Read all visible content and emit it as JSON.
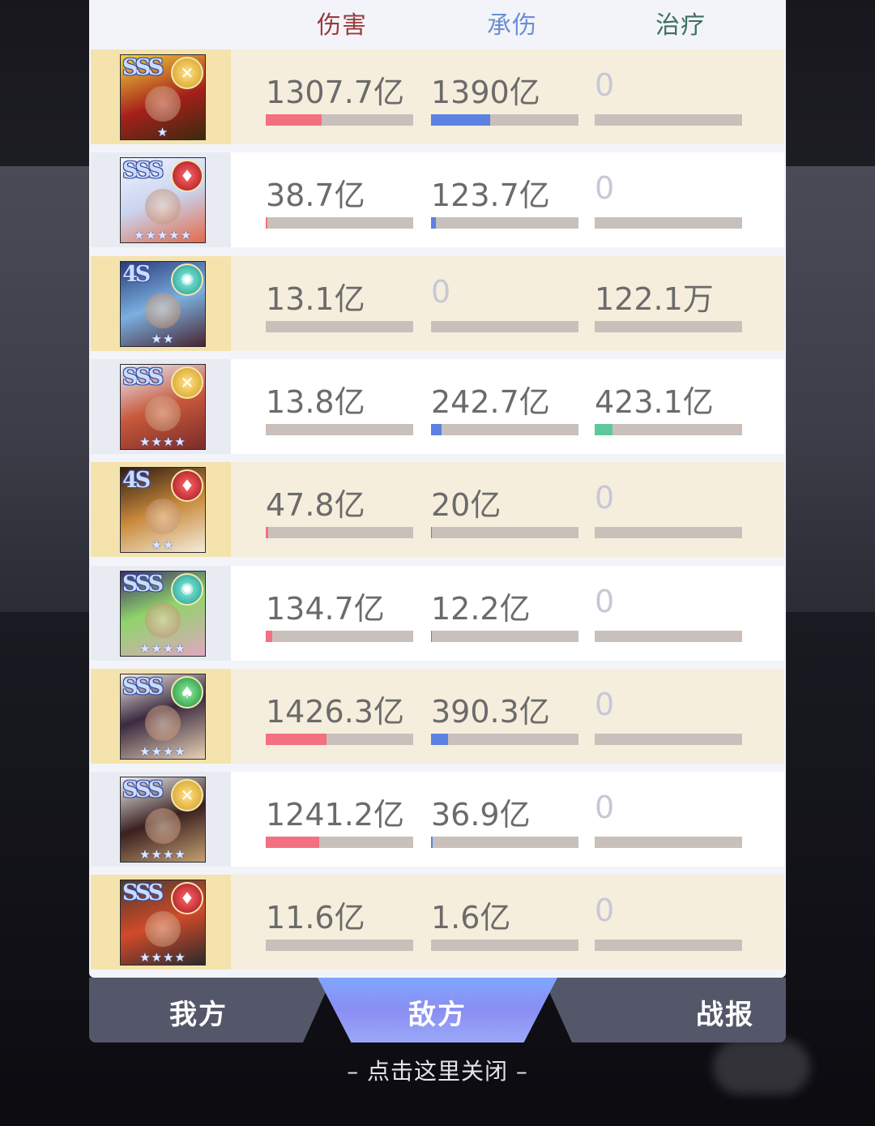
{
  "headers": {
    "damage": "伤害",
    "tanked": "承伤",
    "healing": "治疗"
  },
  "colors": {
    "damage_bar": "#f2707f",
    "tank_bar": "#5b82e3",
    "heal_bar": "#5cc99b",
    "active_tab": "#8a8ef3"
  },
  "rows": [
    {
      "grade": "SSS",
      "element": "light",
      "stars": "★",
      "damage": "1307.7亿",
      "tanked": "1390亿",
      "healing": "0",
      "damage_frac": 0.38,
      "tank_frac": 0.4,
      "heal_frac": 0
    },
    {
      "grade": "SSS",
      "element": "fire",
      "stars": "★★★★★",
      "damage": "38.7亿",
      "tanked": "123.7亿",
      "healing": "0",
      "damage_frac": 0.01,
      "tank_frac": 0.035,
      "heal_frac": 0
    },
    {
      "grade": "4S",
      "element": "wind",
      "stars": "★★",
      "damage": "13.1亿",
      "tanked": "0",
      "healing": "122.1万",
      "damage_frac": 0,
      "tank_frac": 0,
      "heal_frac": 0
    },
    {
      "grade": "SSS",
      "element": "light",
      "stars": "★★★★",
      "damage": "13.8亿",
      "tanked": "242.7亿",
      "healing": "423.1亿",
      "damage_frac": 0,
      "tank_frac": 0.07,
      "heal_frac": 0.12
    },
    {
      "grade": "4S",
      "element": "fire",
      "stars": "★★",
      "damage": "47.8亿",
      "tanked": "20亿",
      "healing": "0",
      "damage_frac": 0.015,
      "tank_frac": 0.006,
      "heal_frac": 0
    },
    {
      "grade": "SSS",
      "element": "wind",
      "stars": "★★★★",
      "damage": "134.7亿",
      "tanked": "12.2亿",
      "healing": "0",
      "damage_frac": 0.045,
      "tank_frac": 0.004,
      "heal_frac": 0
    },
    {
      "grade": "SSS",
      "element": "earth",
      "stars": "★★★★",
      "damage": "1426.3亿",
      "tanked": "390.3亿",
      "healing": "0",
      "damage_frac": 0.41,
      "tank_frac": 0.115,
      "heal_frac": 0
    },
    {
      "grade": "SSS",
      "element": "light",
      "stars": "★★★★",
      "damage": "1241.2亿",
      "tanked": "36.9亿",
      "healing": "0",
      "damage_frac": 0.36,
      "tank_frac": 0.01,
      "heal_frac": 0
    },
    {
      "grade": "SSS",
      "element": "fire",
      "stars": "★★★★",
      "damage": "11.6亿",
      "tanked": "1.6亿",
      "healing": "0",
      "damage_frac": 0,
      "tank_frac": 0,
      "heal_frac": 0
    }
  ],
  "tabs": {
    "ours": "我方",
    "enemy": "敌方",
    "report": "战报",
    "active": "enemy"
  },
  "close_hint": "– 点击这里关闭 –"
}
